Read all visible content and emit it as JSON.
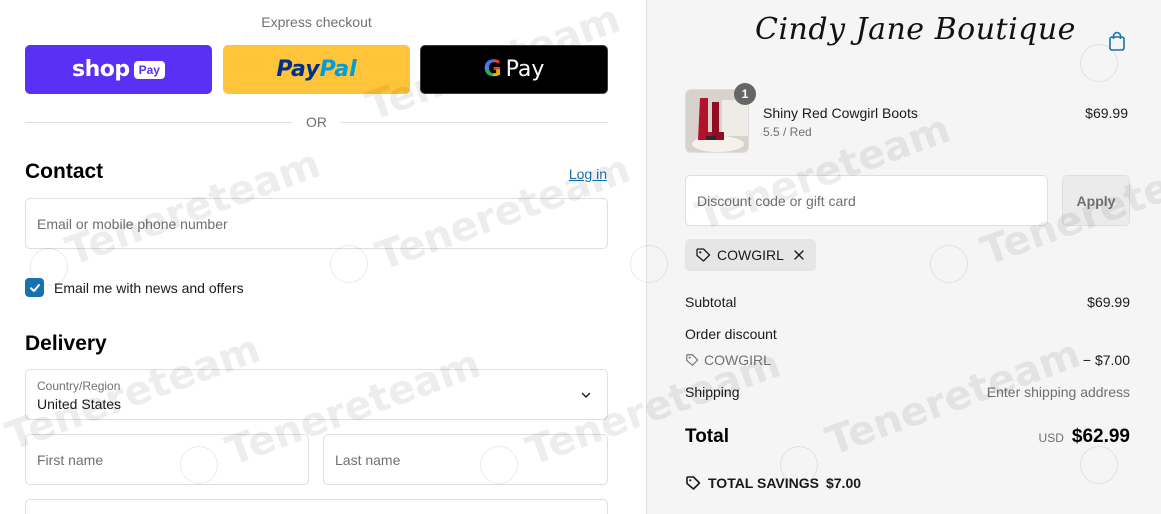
{
  "express": {
    "label": "Express checkout",
    "shop_word": "shop",
    "shop_chip": "Pay",
    "paypal_pay": "Pay",
    "paypal_pal": "Pal",
    "gpay_g": "G",
    "gpay_word": "Pay",
    "or_text": "OR"
  },
  "contact": {
    "title": "Contact",
    "login": "Log in",
    "email_placeholder": "Email or mobile phone number",
    "newsletter_label": "Email me with news and offers",
    "newsletter_checked": true
  },
  "delivery": {
    "title": "Delivery",
    "country_label": "Country/Region",
    "country_value": "United States",
    "first_name_placeholder": "First name",
    "last_name_placeholder": "Last name"
  },
  "brand": {
    "name": "Cindy Jane Boutique"
  },
  "cart": {
    "item": {
      "name": "Shiny Red Cowgirl Boots",
      "variant": "5.5 / Red",
      "price": "$69.99",
      "quantity": "1"
    },
    "discount_placeholder": "Discount code or gift card",
    "apply_label": "Apply",
    "applied_code": "COWGIRL"
  },
  "summary": {
    "subtotal_label": "Subtotal",
    "subtotal_value": "$69.99",
    "order_discount_label": "Order discount",
    "discount_code": "COWGIRL",
    "discount_value": "− $7.00",
    "shipping_label": "Shipping",
    "shipping_value": "Enter shipping address",
    "total_label": "Total",
    "total_currency": "USD",
    "total_value": "$62.99",
    "savings_label": "TOTAL SAVINGS",
    "savings_value": "$7.00"
  },
  "watermark": {
    "text": "Tenereteam"
  },
  "colors": {
    "shop_pay": "#5a31f4",
    "paypal": "#ffc439",
    "gpay": "#000000",
    "link_blue": "#1773b0",
    "sidebar_bg": "#f5f5f5"
  }
}
